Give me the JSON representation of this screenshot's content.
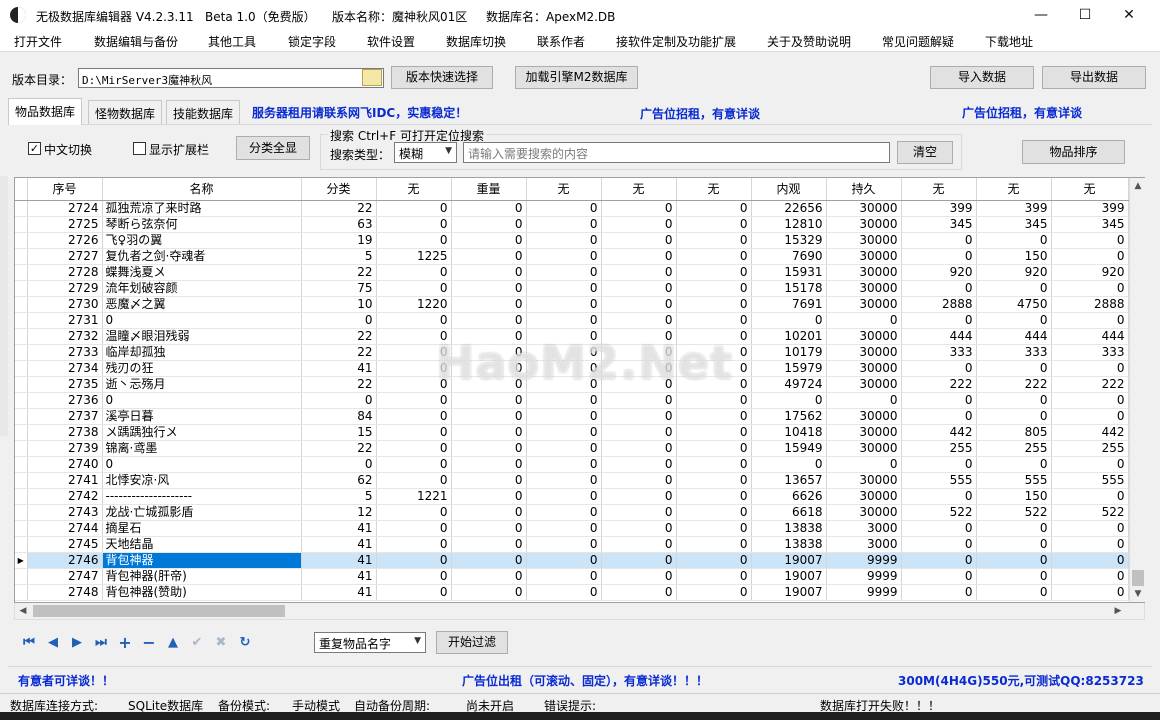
{
  "window": {
    "title_app": "无极数据库编辑器 V4.2.3.11",
    "title_beta": "Beta 1.0（免费版）",
    "title_version": "版本名称：魔神秋风01区",
    "title_db": "数据库名：ApexM2.DB",
    "minimize": "—",
    "maximize": "☐",
    "close": "✕"
  },
  "menu": [
    "打开文件",
    "数据编辑与备份",
    "其他工具",
    "锁定字段",
    "软件设置",
    "数据库切换",
    "联系作者",
    "接软件定制及功能扩展",
    "关于及赞助说明",
    "常见问题解疑",
    "下载地址"
  ],
  "toolbar": {
    "dir_label": "版本目录：",
    "dir_value": "D:\\MirServer3魔神秋风",
    "quick_select": "版本快速选择",
    "load_db": "加载引擎M2数据库",
    "import": "导入数据",
    "export": "导出数据"
  },
  "tabs": [
    "物品数据库",
    "怪物数据库",
    "技能数据库"
  ],
  "ads": {
    "server": "服务器租用请联系网飞IDC，实惠稳定！",
    "ad1": "广告位招租，有意详谈",
    "ad2": "广告位招租，有意详谈",
    "bottom_left": "有意者可详谈！！",
    "bottom_center": "广告位出租（可滚动、固定），有意详谈！！！",
    "bottom_right": "300M(4H4G)550元,可测试QQ:8253723"
  },
  "filters": {
    "chinese_toggle": "中文切换",
    "chinese_checked": true,
    "show_extended": "显示扩展栏",
    "show_extended_checked": false,
    "category_all": "分类全显",
    "search_hint": "搜索  Ctrl+F 可打开定位搜索",
    "search_type_label": "搜索类型：",
    "search_type_value": "模糊",
    "search_placeholder": "请输入需要搜索的内容",
    "clear": "清空",
    "sort": "物品排序"
  },
  "grid": {
    "columns": [
      "序号",
      "名称",
      "分类",
      "无",
      "重量",
      "无",
      "无",
      "无",
      "内观",
      "持久",
      "无",
      "无",
      "无"
    ],
    "rows": [
      {
        "id": "2724",
        "name": "孤独荒凉了来时路",
        "v": [
          "22",
          "0",
          "0",
          "0",
          "0",
          "0",
          "22656",
          "30000",
          "399",
          "399",
          "399"
        ]
      },
      {
        "id": "2725",
        "name": "琴断ら弦奈何",
        "v": [
          "63",
          "0",
          "0",
          "0",
          "0",
          "0",
          "12810",
          "30000",
          "345",
          "345",
          "345"
        ]
      },
      {
        "id": "2726",
        "name": "飞♀羽の翼",
        "v": [
          "19",
          "0",
          "0",
          "0",
          "0",
          "0",
          "15329",
          "30000",
          "0",
          "0",
          "0"
        ]
      },
      {
        "id": "2727",
        "name": "复仇者之剑·夺魂者",
        "v": [
          "5",
          "1225",
          "0",
          "0",
          "0",
          "0",
          "7690",
          "30000",
          "0",
          "150",
          "0"
        ]
      },
      {
        "id": "2728",
        "name": "蝶舞浅夏〤",
        "v": [
          "22",
          "0",
          "0",
          "0",
          "0",
          "0",
          "15931",
          "30000",
          "920",
          "920",
          "920"
        ]
      },
      {
        "id": "2729",
        "name": "流年划破容颜",
        "v": [
          "75",
          "0",
          "0",
          "0",
          "0",
          "0",
          "15178",
          "30000",
          "0",
          "0",
          "0"
        ]
      },
      {
        "id": "2730",
        "name": "恶魔〆之翼",
        "v": [
          "10",
          "1220",
          "0",
          "0",
          "0",
          "0",
          "7691",
          "30000",
          "2888",
          "4750",
          "2888"
        ]
      },
      {
        "id": "2731",
        "name": "0",
        "v": [
          "0",
          "0",
          "0",
          "0",
          "0",
          "0",
          "0",
          "0",
          "0",
          "0",
          "0"
        ]
      },
      {
        "id": "2732",
        "name": "温瞳〆眼泪残弱",
        "v": [
          "22",
          "0",
          "0",
          "0",
          "0",
          "0",
          "10201",
          "30000",
          "444",
          "444",
          "444"
        ]
      },
      {
        "id": "2733",
        "name": "临岸却孤独",
        "v": [
          "22",
          "0",
          "0",
          "0",
          "0",
          "0",
          "10179",
          "30000",
          "333",
          "333",
          "333"
        ]
      },
      {
        "id": "2734",
        "name": "残刃の狂",
        "v": [
          "41",
          "0",
          "0",
          "0",
          "0",
          "0",
          "15979",
          "30000",
          "0",
          "0",
          "0"
        ]
      },
      {
        "id": "2735",
        "name": "逝丶忈殇月",
        "v": [
          "22",
          "0",
          "0",
          "0",
          "0",
          "0",
          "49724",
          "30000",
          "222",
          "222",
          "222"
        ]
      },
      {
        "id": "2736",
        "name": "0",
        "v": [
          "0",
          "0",
          "0",
          "0",
          "0",
          "0",
          "0",
          "0",
          "0",
          "0",
          "0"
        ]
      },
      {
        "id": "2737",
        "name": "溪亭日暮",
        "v": [
          "84",
          "0",
          "0",
          "0",
          "0",
          "0",
          "17562",
          "30000",
          "0",
          "0",
          "0"
        ]
      },
      {
        "id": "2738",
        "name": "〤踽踽独行〤",
        "v": [
          "15",
          "0",
          "0",
          "0",
          "0",
          "0",
          "10418",
          "30000",
          "442",
          "805",
          "442"
        ]
      },
      {
        "id": "2739",
        "name": "锦离·鸢墨",
        "v": [
          "22",
          "0",
          "0",
          "0",
          "0",
          "0",
          "15949",
          "30000",
          "255",
          "255",
          "255"
        ]
      },
      {
        "id": "2740",
        "name": "0",
        "v": [
          "0",
          "0",
          "0",
          "0",
          "0",
          "0",
          "0",
          "0",
          "0",
          "0",
          "0"
        ]
      },
      {
        "id": "2741",
        "name": "北悸安凉·风",
        "v": [
          "62",
          "0",
          "0",
          "0",
          "0",
          "0",
          "13657",
          "30000",
          "555",
          "555",
          "555"
        ]
      },
      {
        "id": "2742",
        "name": "--------------------",
        "v": [
          "5",
          "1221",
          "0",
          "0",
          "0",
          "0",
          "6626",
          "30000",
          "0",
          "150",
          "0"
        ]
      },
      {
        "id": "2743",
        "name": "龙战·亡城孤影盾",
        "v": [
          "12",
          "0",
          "0",
          "0",
          "0",
          "0",
          "6618",
          "30000",
          "522",
          "522",
          "522"
        ]
      },
      {
        "id": "2744",
        "name": "摘星石",
        "v": [
          "41",
          "0",
          "0",
          "0",
          "0",
          "0",
          "13838",
          "3000",
          "0",
          "0",
          "0"
        ]
      },
      {
        "id": "2745",
        "name": "天地结晶",
        "v": [
          "41",
          "0",
          "0",
          "0",
          "0",
          "0",
          "13838",
          "3000",
          "0",
          "0",
          "0"
        ]
      },
      {
        "id": "2746",
        "name": "背包神器",
        "v": [
          "41",
          "0",
          "0",
          "0",
          "0",
          "0",
          "19007",
          "9999",
          "0",
          "0",
          "0"
        ],
        "selected": true
      },
      {
        "id": "2747",
        "name": "背包神器(肝帝)",
        "v": [
          "41",
          "0",
          "0",
          "0",
          "0",
          "0",
          "19007",
          "9999",
          "0",
          "0",
          "0"
        ]
      },
      {
        "id": "2748",
        "name": "背包神器(赞助)",
        "v": [
          "41",
          "0",
          "0",
          "0",
          "0",
          "0",
          "19007",
          "9999",
          "0",
          "0",
          "0"
        ]
      }
    ]
  },
  "bottom_tools": {
    "dup_select": "重复物品名字",
    "start_filter": "开始过滤",
    "nav_icons": [
      "first-icon",
      "prev-icon",
      "next-icon",
      "last-icon",
      "add-icon",
      "delete-icon",
      "edit-up-icon",
      "confirm-icon",
      "cancel-icon",
      "refresh-icon"
    ],
    "nav_glyphs": [
      "⏮",
      "◀",
      "▶",
      "⏭",
      "+",
      "−",
      "▲",
      "✔",
      "✖",
      "↻"
    ]
  },
  "status": {
    "conn_label": "数据库连接方式:",
    "conn_value": "SQLite数据库",
    "backup_label": "备份模式:",
    "backup_value": "手动模式",
    "auto_label": "自动备份周期:",
    "auto_value": "尚未开启",
    "error_label": "错误提示:",
    "error_value": "数据库打开失败！！！"
  },
  "watermark": "HaoM2.Net",
  "colors": {
    "ad_blue": "#0a2bd1",
    "selection": "#0078d7",
    "selection_row": "#cce4f7"
  }
}
